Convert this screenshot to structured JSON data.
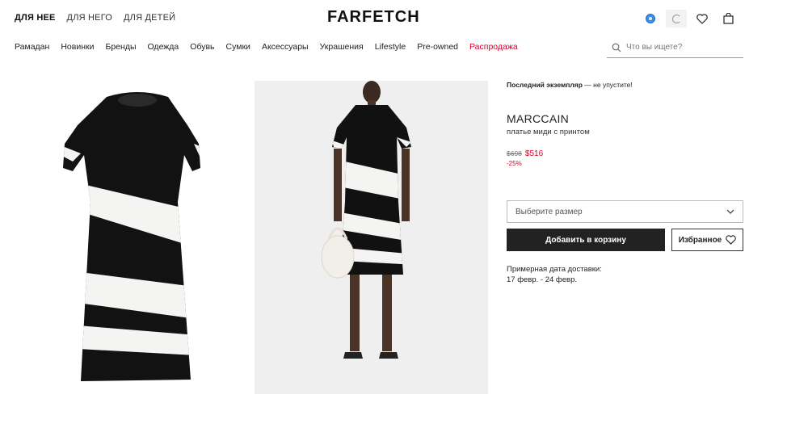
{
  "header": {
    "gender_tabs": [
      "ДЛЯ НЕЕ",
      "ДЛЯ НЕГО",
      "ДЛЯ ДЕТЕЙ"
    ],
    "logo": "FARFETCH",
    "icons": [
      "globe-icon",
      "loading-icon",
      "heart-icon",
      "bag-icon"
    ]
  },
  "nav": {
    "items": [
      "Рамадан",
      "Новинки",
      "Бренды",
      "Одежда",
      "Обувь",
      "Сумки",
      "Аксессуары",
      "Украшения",
      "Lifestyle",
      "Pre-owned"
    ],
    "sale": "Распродажа",
    "sale_color": "#d6002b"
  },
  "search": {
    "placeholder": "Что вы ищете?"
  },
  "product": {
    "stock_bold": "Последний экземпляр",
    "stock_rest": " — не упустите!",
    "brand": "MARCCAIN",
    "name": "платье миди с принтом",
    "old_price": "$698",
    "new_price": "$516",
    "discount": "-25%",
    "size_placeholder": "Выберите размер",
    "add_to_cart": "Добавить в корзину",
    "favorite": "Избранное",
    "delivery_label": "Примерная дата доставки:",
    "delivery_dates": "17 февр. - 24 февр."
  }
}
